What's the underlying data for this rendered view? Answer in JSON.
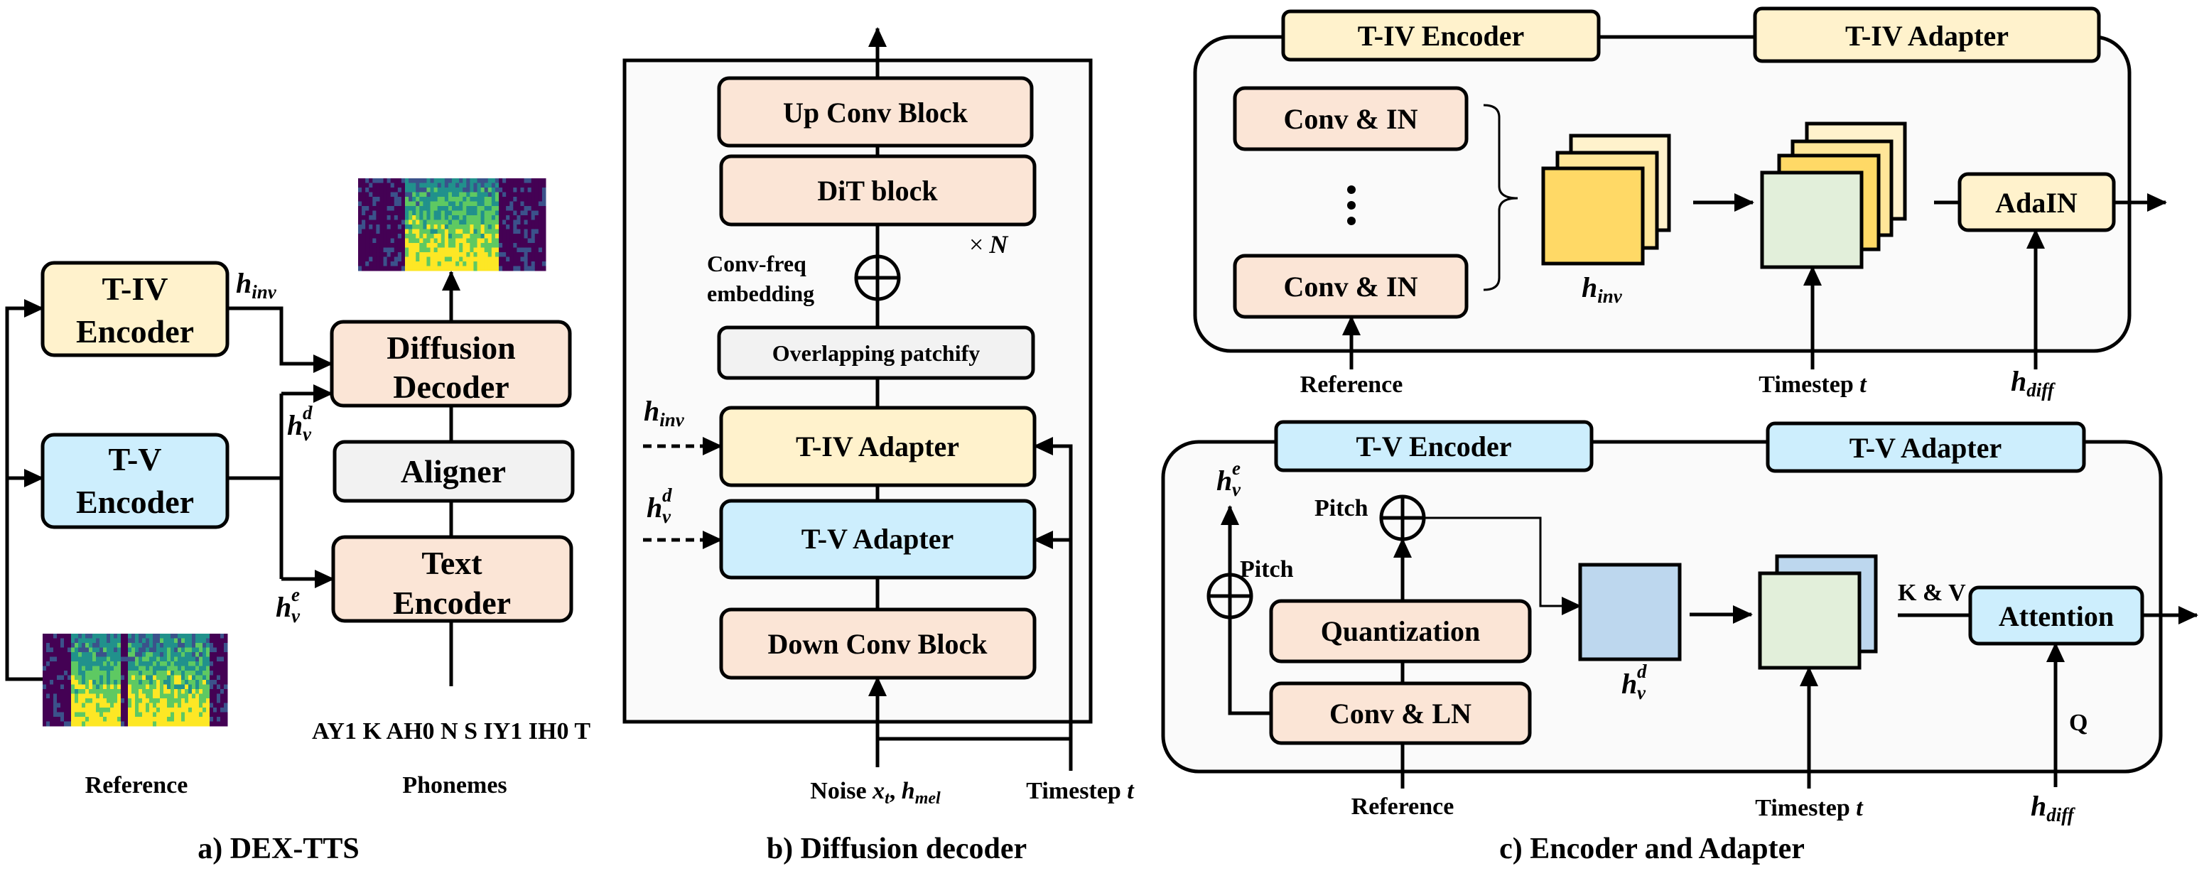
{
  "colors": {
    "peach": "#fbe5d6",
    "light_yellow": "#fff2cc",
    "mid_yellow": "#ffe699",
    "yellow": "#ffd966",
    "light_blue": "#cdeefd",
    "blue": "#bdd7ee",
    "green": "#e2efda",
    "gray": "#f2f2f2",
    "panel": "#fafafa"
  },
  "panel_a": {
    "caption": "a) DEX-TTS",
    "tiv_encoder": [
      "T-IV",
      "Encoder"
    ],
    "tv_encoder": [
      "T-V",
      "Encoder"
    ],
    "diffusion_decoder": [
      "Diffusion",
      "Decoder"
    ],
    "aligner": "Aligner",
    "text_encoder": [
      "Text",
      "Encoder"
    ],
    "phoneme_sequence": "AY1 K AH0 N S IY1 IH0 T",
    "reference_label": "Reference",
    "phonemes_label": "Phonemes",
    "h_inv": {
      "base": "h",
      "sub": "inv"
    },
    "h_v_d": {
      "base": "h",
      "sub": "v",
      "sup": "d"
    },
    "h_v_e": {
      "base": "h",
      "sub": "v",
      "sup": "e"
    }
  },
  "panel_b": {
    "caption": "b) Diffusion decoder",
    "up_conv": "Up Conv Block",
    "dit": "DiT block",
    "times_n": {
      "times": "×",
      "n": "N"
    },
    "conv_freq": [
      "Conv-freq",
      "embedding"
    ],
    "patchify": "Overlapping patchify",
    "tiv_adapter": "T-IV Adapter",
    "tv_adapter": "T-V Adapter",
    "down_conv": "Down Conv Block",
    "h_inv": {
      "base": "h",
      "sub": "inv"
    },
    "h_v_d": {
      "base": "h",
      "sub": "v",
      "sup": "d"
    },
    "noise_label": {
      "word": "Noise",
      "x": "x",
      "x_sub": "t",
      "comma": ",",
      "h": "h",
      "h_sub": "mel"
    },
    "timestep_label": {
      "word": "Timestep",
      "t": "t"
    }
  },
  "panel_c": {
    "caption": "c) Encoder and Adapter",
    "tiv": {
      "encoder_tab": "T-IV Encoder",
      "adapter_tab": "T-IV Adapter",
      "conv_in": "Conv & IN",
      "ellipsis": "⋮",
      "h_inv": {
        "base": "h",
        "sub": "inv"
      },
      "adain": "AdaIN",
      "reference_label": "Reference",
      "timestep_label": {
        "word": "Timestep",
        "t": "t"
      },
      "h_diff": {
        "base": "h",
        "sub": "diff"
      }
    },
    "tv": {
      "encoder_tab": "T-V Encoder",
      "adapter_tab": "T-V Adapter",
      "h_v_e": {
        "base": "h",
        "sub": "v",
        "sup": "e"
      },
      "pitch": "Pitch",
      "quantization": "Quantization",
      "conv_ln": "Conv & LN",
      "h_v_d": {
        "base": "h",
        "sub": "v",
        "sup": "d"
      },
      "kv": "K & V",
      "attention": "Attention",
      "q": "Q",
      "reference_label": "Reference",
      "timestep_label": {
        "word": "Timestep",
        "t": "t"
      },
      "h_diff": {
        "base": "h",
        "sub": "diff"
      }
    }
  }
}
